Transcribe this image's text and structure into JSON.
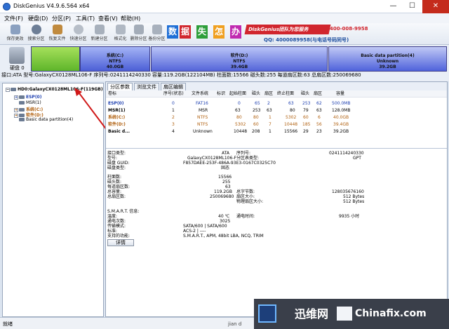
{
  "window": {
    "title": "DiskGenius V4.9.6.564 x64",
    "minimize": "—",
    "maximize": "☐",
    "close": "✕"
  },
  "menu": [
    "文件(F)",
    "硬盘(D)",
    "分区(P)",
    "工具(T)",
    "查看(V)",
    "帮助(H)"
  ],
  "toolbar": [
    {
      "label": "保存更改",
      "icon": "save-icon",
      "color": "#8aa0c0"
    },
    {
      "label": "搜索分区",
      "icon": "search-icon",
      "color": "#6d7e96"
    },
    {
      "label": "恢复文件",
      "icon": "recover-icon",
      "color": "#c08a3e"
    },
    {
      "label": "快速分区",
      "icon": "quick-partition-icon",
      "color": "#b7bec8"
    },
    {
      "label": "新建分区",
      "icon": "new-partition-icon",
      "color": "#a7b0bc"
    },
    {
      "label": "格式化",
      "icon": "format-icon",
      "color": "#b0b8c3"
    },
    {
      "label": "删除分区",
      "icon": "delete-icon",
      "color": "#a3acb8"
    },
    {
      "label": "备份分区",
      "icon": "backup-icon",
      "color": "#a8b1bd"
    }
  ],
  "banner": {
    "tiles": [
      "数",
      "据",
      "失",
      "怎",
      "办"
    ],
    "tile_colors": [
      "#1f6fd6",
      "#d1262e",
      "#2d9e3a",
      "#f0a020",
      "#c02ab0"
    ],
    "promo": "DiskGenius团队为您服务",
    "price": "400-008-9958",
    "qq": "QQ: 4000089958(与电话号码同号)"
  },
  "diskmap": {
    "disk_label": "硬盘 0",
    "partitions": [
      {
        "name": "系统(C:)",
        "fs": "NTFS",
        "size": "40.0GB"
      },
      {
        "name": "软件(D:)",
        "fs": "NTFS",
        "size": "39.4GB"
      },
      {
        "name": "Basic data partition(4)",
        "fs": "Unknown",
        "size": "39.2GB"
      }
    ],
    "info": "接口:ATA  型号:GalaxyCX0128ML106-F  序列号:0241114240330  容量:119.2GB(122104MB)  柱面数:15566  磁头数:255  每道扇区数:63  总扇区数:250069680"
  },
  "tree": {
    "disk": "HD0:GalaxyCX0128ML106-F(119GB)",
    "items": [
      {
        "label": "ESP(0)",
        "color": "#1d3fb0"
      },
      {
        "label": "MSR(1)",
        "color": "#000000"
      },
      {
        "label": "系统(C:)",
        "color": "#b0600f"
      },
      {
        "label": "软件(D:)",
        "color": "#b0600f"
      },
      {
        "label": "Basic data partition(4)",
        "color": "#000000"
      }
    ]
  },
  "tabs": [
    "分区参数",
    "浏览文件",
    "扇区编辑"
  ],
  "partition_table": {
    "headers": [
      "卷标",
      "序号(状态)",
      "文件系统",
      "标识",
      "起始柱面",
      "磁头",
      "扇区",
      "终止柱面",
      "磁头",
      "扇区",
      "容量"
    ],
    "rows": [
      [
        "ESP(0)",
        "0",
        "FAT16",
        "",
        "0",
        "65",
        "2",
        "63",
        "253",
        "62",
        "500.0MB"
      ],
      [
        "MSR(1)",
        "1",
        "MSR",
        "",
        "63",
        "253",
        "63",
        "80",
        "79",
        "63",
        "128.0MB"
      ],
      [
        "系统(C:)",
        "2",
        "NTFS",
        "",
        "80",
        "80",
        "1",
        "5302",
        "60",
        "6",
        "40.0GB"
      ],
      [
        "软件(D:)",
        "3",
        "NTFS",
        "",
        "5302",
        "60",
        "7",
        "10448",
        "185",
        "56",
        "39.4GB"
      ],
      [
        "Basic d...",
        "4",
        "Unknown",
        "",
        "10448",
        "208",
        "1",
        "15566",
        "29",
        "23",
        "39.2GB"
      ]
    ]
  },
  "details": {
    "left": [
      {
        "k": "接口类型:",
        "v": "ATA"
      },
      {
        "k": "型号:",
        "v": "GalaxyCX0128ML106-F"
      },
      {
        "k": "磁盘 GUID:",
        "v": "F857DAEE-253F-486A-93E3-0167C0325C70"
      },
      {
        "k": "磁盘类型:",
        "v": "固态"
      },
      {
        "k": "柱面数:",
        "v": "15566"
      },
      {
        "k": "磁头数:",
        "v": "255"
      },
      {
        "k": "每道扇区数:",
        "v": "63"
      },
      {
        "k": "总容量:",
        "v": "119.2GB"
      },
      {
        "k": "总扇区数:",
        "v": "250069680"
      }
    ],
    "right": [
      {
        "k": "序列号:",
        "v": "0241114240330"
      },
      {
        "k": "分区表类型:",
        "v": "GPT"
      },
      {
        "k": "总字节数:",
        "v": "128035676160"
      },
      {
        "k": "扇区大小:",
        "v": "512 Bytes"
      },
      {
        "k": "物理扇区大小:",
        "v": "512 Bytes"
      }
    ],
    "smart": [
      {
        "k": "S.M.A.R.T. 信息:",
        "v": ""
      },
      {
        "k": "温度:",
        "v": "40 ℃"
      },
      {
        "k": "通电次数:",
        "v": "3025"
      },
      {
        "k": "传输模式:",
        "v": "SATA/600 | SATA/600"
      },
      {
        "k": "标准:",
        "v": "ACS-2 | ----"
      },
      {
        "k": "支持的功能:",
        "v": "S.M.A.R.T., APM, 48bit LBA, NCQ, TRIM"
      }
    ],
    "smart_right": {
      "k": "通电时间:",
      "v": "9935 小时"
    },
    "detail_button": "详情"
  },
  "status": "就绪",
  "watermark": {
    "cn": "迅维网",
    "en": "Chinafix.com",
    "under": "jian d"
  }
}
